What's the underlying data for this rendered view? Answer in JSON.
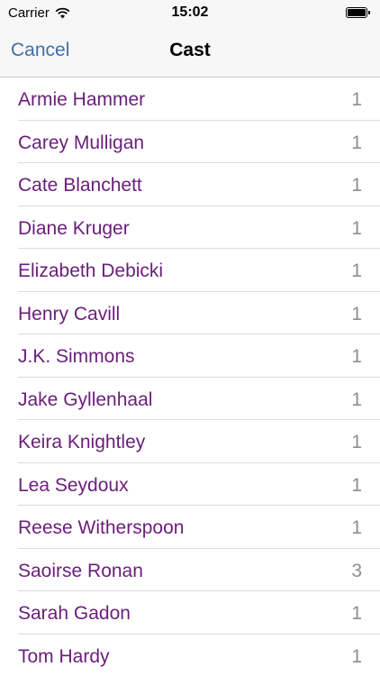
{
  "status_bar": {
    "carrier": "Carrier",
    "time": "15:02",
    "wifi_icon": "wifi-icon",
    "battery_icon": "battery-icon",
    "battery_level": 1.0
  },
  "nav": {
    "cancel_label": "Cancel",
    "title": "Cast"
  },
  "colors": {
    "accent": "#3f6fa8",
    "item_text": "#6a1e7a",
    "count_text": "#8e8e93"
  },
  "cast": [
    {
      "name": "Armie Hammer",
      "count": "1"
    },
    {
      "name": "Carey Mulligan",
      "count": "1"
    },
    {
      "name": "Cate Blanchett",
      "count": "1"
    },
    {
      "name": "Diane Kruger",
      "count": "1"
    },
    {
      "name": "Elizabeth Debicki",
      "count": "1"
    },
    {
      "name": "Henry Cavill",
      "count": "1"
    },
    {
      "name": "J.K. Simmons",
      "count": "1"
    },
    {
      "name": "Jake Gyllenhaal",
      "count": "1"
    },
    {
      "name": "Keira Knightley",
      "count": "1"
    },
    {
      "name": "Lea Seydoux",
      "count": "1"
    },
    {
      "name": "Reese Witherspoon",
      "count": "1"
    },
    {
      "name": "Saoirse Ronan",
      "count": "3"
    },
    {
      "name": "Sarah Gadon",
      "count": "1"
    },
    {
      "name": "Tom Hardy",
      "count": "1"
    }
  ]
}
